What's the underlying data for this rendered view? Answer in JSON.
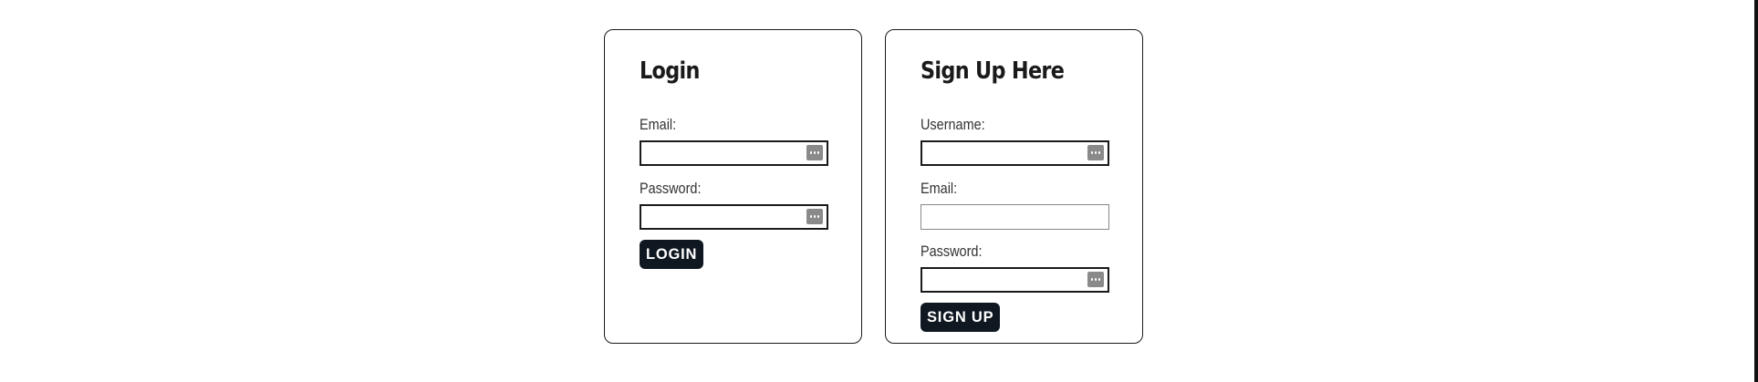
{
  "login": {
    "title": "Login",
    "email_label": "Email:",
    "password_label": "Password:",
    "button_label": "LOGIN"
  },
  "signup": {
    "title": "Sign Up Here",
    "username_label": "Username:",
    "email_label": "Email:",
    "password_label": "Password:",
    "button_label": "SIGN UP"
  },
  "icons": {
    "field_autofill": "password-manager-icon"
  },
  "colors": {
    "button_bg": "#0f1720",
    "button_text": "#ffffff",
    "card_border": "#1a1a1a",
    "field_icon_bg": "#8a8a8a"
  }
}
